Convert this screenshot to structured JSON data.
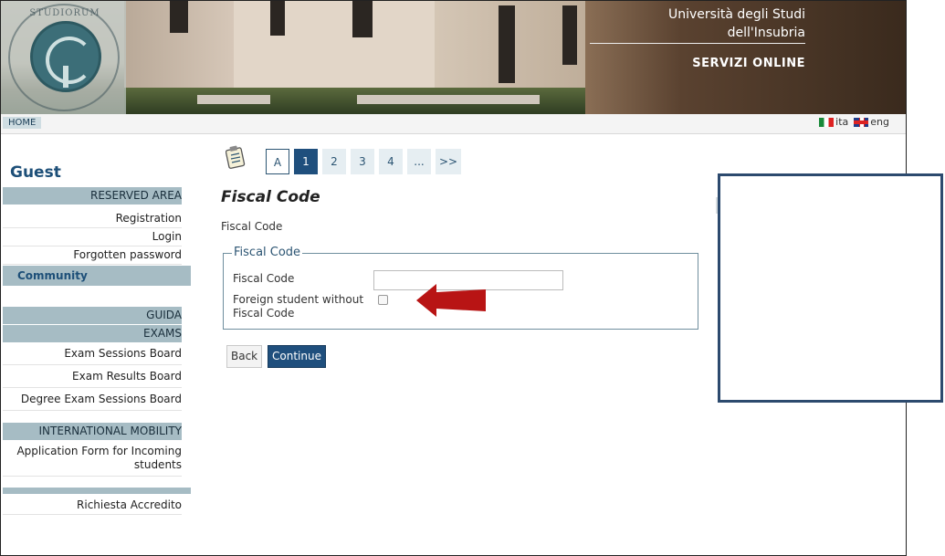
{
  "header": {
    "university_line1": "Università degli Studi",
    "university_line2": "dell'Insubria",
    "services": "SERVIZI ONLINE",
    "seal_text": "STUDIORUM"
  },
  "topbar": {
    "home_label": "HOME",
    "lang_it": "ita",
    "lang_en": "eng"
  },
  "sidebar": {
    "user": "Guest",
    "reserved_area": "RESERVED AREA",
    "registration": "Registration",
    "login": "Login",
    "forgotten_password": "Forgotten password",
    "community": "Community",
    "guida": "GUIDA",
    "exams": "EXAMS",
    "exam_sessions_board": "Exam Sessions Board",
    "exam_results_board": "Exam Results Board",
    "degree_exam_sessions_board": "Degree Exam Sessions Board",
    "international_mobility": "INTERNATIONAL MOBILITY",
    "application_form_1": "Application Form for Incoming",
    "application_form_2": "students",
    "richiesta_accredito": "Richiesta Accredito"
  },
  "pager": {
    "items": [
      "A",
      "1",
      "2",
      "3",
      "4",
      "...",
      ">>"
    ],
    "active": "1"
  },
  "main": {
    "title": "Fiscal Code",
    "subtitle": "Fiscal Code",
    "fieldset_legend": "Fiscal Code",
    "fiscal_code_label": "Fiscal Code",
    "fiscal_code_value": "",
    "foreign_label_1": "Foreign student without",
    "foreign_label_2": "Fiscal Code",
    "foreign_checked": false,
    "back_label": "Back",
    "continue_label": "Continue"
  },
  "colors": {
    "accent": "#1f4f7d",
    "sidebar_header": "#a6bcc4",
    "annotation_arrow": "#b81414",
    "overlay_border": "#2c4a6e"
  },
  "icons": {
    "clipboard": "clipboard-icon",
    "arrow": "red-arrow-icon"
  }
}
